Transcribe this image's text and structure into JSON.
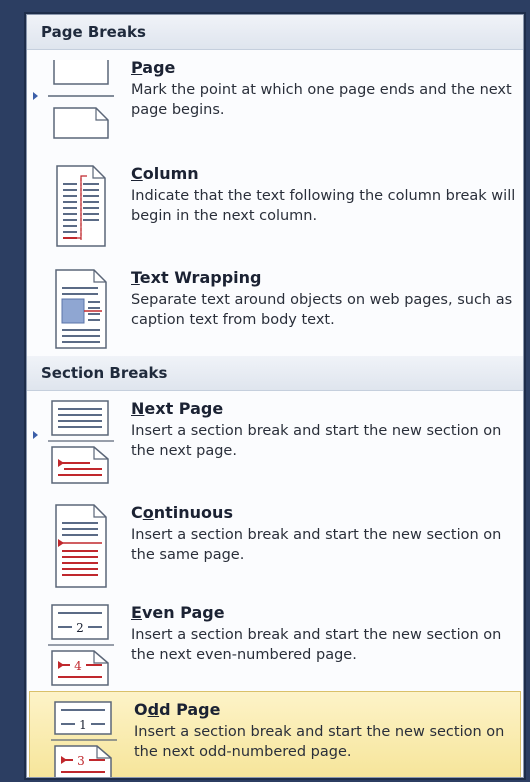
{
  "page_breaks": {
    "header": "Page Breaks",
    "items": [
      {
        "title_pre": "",
        "title_key": "P",
        "title_post": "age",
        "description": "Mark the point at which one page ends and the next page begins.",
        "icon": "page-break-icon"
      },
      {
        "title_pre": "",
        "title_key": "C",
        "title_post": "olumn",
        "description": "Indicate that the text following the column break will begin in the next column.",
        "icon": "column-break-icon"
      },
      {
        "title_pre": "",
        "title_key": "T",
        "title_post": "ext Wrapping",
        "description": "Separate text around objects on web pages, such as caption text from body text.",
        "icon": "text-wrapping-icon"
      }
    ]
  },
  "section_breaks": {
    "header": "Section Breaks",
    "items": [
      {
        "title_pre": "",
        "title_key": "N",
        "title_post": "ext Page",
        "description": "Insert a section break and start the new section on the next page.",
        "icon": "next-page-icon"
      },
      {
        "title_pre": "C",
        "title_key": "o",
        "title_post": "ntinuous",
        "description": "Insert a section break and start the new section on the same page.",
        "icon": "continuous-icon"
      },
      {
        "title_pre": "",
        "title_key": "E",
        "title_post": "ven Page",
        "description": "Insert a section break and start the new section on the next even-numbered page.",
        "icon": "even-page-icon",
        "numbers": [
          "2",
          "4"
        ]
      },
      {
        "title_pre": "O",
        "title_key": "d",
        "title_post": "d Page",
        "description": "Insert a section break and start the new section on the next odd-numbered page.",
        "icon": "odd-page-icon",
        "numbers": [
          "1",
          "3"
        ],
        "highlighted": true
      }
    ]
  },
  "colors": {
    "highlight": "#f6e59a",
    "accent_red": "#c0282d",
    "accent_blue": "#3b5ea8"
  }
}
